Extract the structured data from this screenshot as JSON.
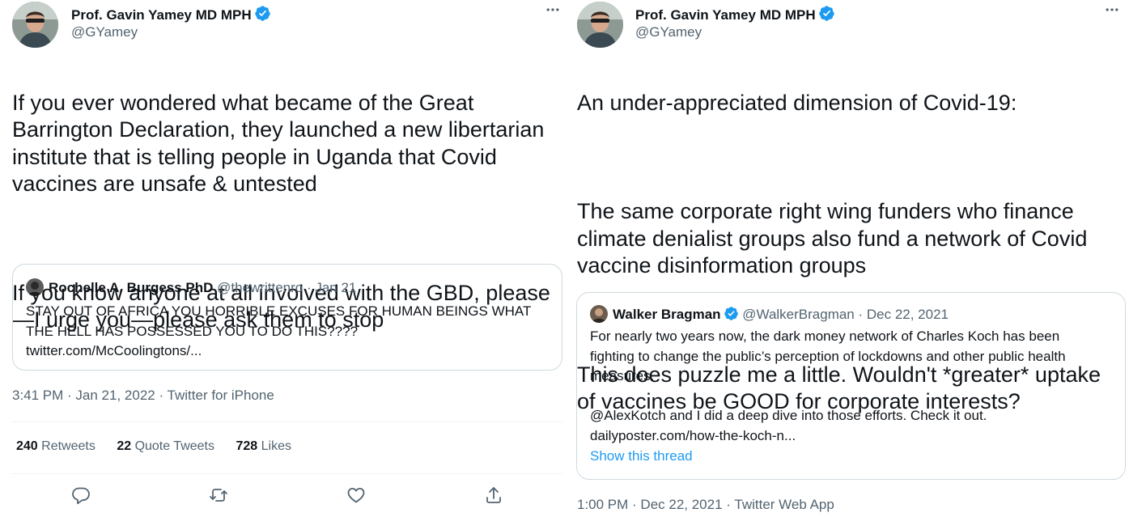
{
  "tweets": [
    {
      "author_name": "Prof. Gavin Yamey MD MPH",
      "handle": "@GYamey",
      "paragraphs": [
        "If you ever wondered what became of the Great\nBarrington Declaration, they launched a new libertarian\ninstitute that is telling people in Uganda that Covid\nvaccines are unsafe & untested",
        "If you know anyone at all involved with the GBD, please\n—I urge you—please ask them to stop"
      ],
      "quote": {
        "author_name": "Rochelle A. Burgess PhD",
        "meta": "@thewrittenro · Jan 21",
        "text": "STAY OUT OF AFRICA YOU HORRIBLE EXCUSES FOR HUMAN BEINGS WHAT\nTHE HELL HAS POSSESSED YOU TO DO THIS????\ntwitter.com/McCoolingtons/..."
      },
      "timestamp_time": "3:41 PM",
      "timestamp_date": "Jan 21, 2022",
      "timestamp_source": "Twitter for iPhone",
      "stats": [
        {
          "count": "240",
          "label": "Retweets"
        },
        {
          "count": "22",
          "label": "Quote Tweets"
        },
        {
          "count": "728",
          "label": "Likes"
        }
      ]
    },
    {
      "author_name": "Prof. Gavin Yamey MD MPH",
      "handle": "@GYamey",
      "paragraphs": [
        "An under-appreciated dimension of Covid-19:",
        "The same corporate right wing funders who finance\nclimate denialist groups also fund a network of Covid\nvaccine disinformation groups",
        "This does puzzle me a little. Wouldn't *greater* uptake\nof vaccines be GOOD for corporate interests?"
      ],
      "quote": {
        "author_name": "Walker Bragman",
        "meta": "@WalkerBragman · Dec 22, 2021",
        "text": "For nearly two years now, the dark money network of Charles Koch has been\nfighting to change the public’s perception of lockdowns and other public health\nmeasures.\n\n@AlexKotch and I did a deep dive into those efforts. Check it out.\ndailyposter.com/how-the-koch-n...",
        "link": "Show this thread"
      },
      "timestamp_time": "1:00 PM",
      "timestamp_date": "Dec 22, 2021",
      "timestamp_source": "Twitter Web App"
    }
  ],
  "colors": {
    "text": "#0f1419",
    "secondary": "#536471",
    "accent": "#1d9bf0",
    "border": "#cfd9de",
    "divider": "#eff3f4"
  },
  "icons": {
    "more": "more-horizontal-icon",
    "verified": "verified-badge-icon",
    "reply": "reply-icon",
    "retweet": "retweet-icon",
    "like": "heart-icon",
    "share": "share-icon"
  }
}
